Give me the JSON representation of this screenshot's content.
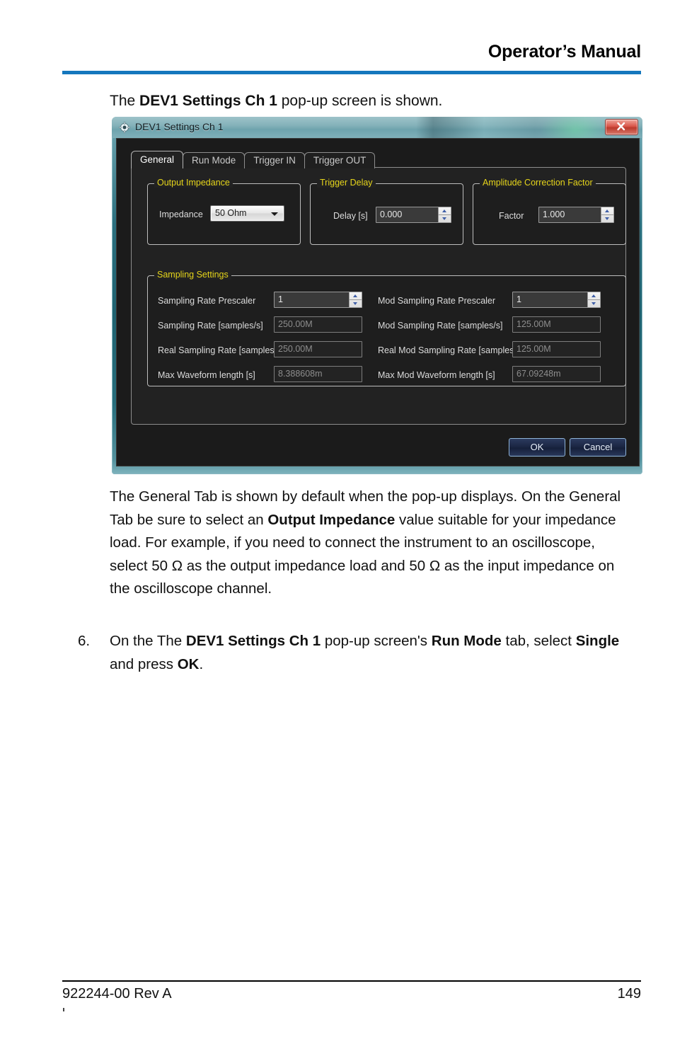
{
  "header": {
    "title": "Operator’s Manual"
  },
  "intro": {
    "before": "The ",
    "bold": "DEV1 Settings Ch 1",
    "after": " pop-up screen is shown."
  },
  "dialog": {
    "title": "DEV1 Settings Ch 1",
    "icon": "gear-icon",
    "close_label": "x",
    "tabs": [
      {
        "label": "General",
        "active": true
      },
      {
        "label": "Run Mode",
        "active": false
      },
      {
        "label": "Trigger IN",
        "active": false
      },
      {
        "label": "Trigger OUT",
        "active": false
      }
    ],
    "groups": {
      "output_impedance": {
        "legend": "Output Impedance",
        "field_label": "Impedance",
        "value": "50 Ohm",
        "options": [
          "50 Ohm"
        ]
      },
      "trigger_delay": {
        "legend": "Trigger Delay",
        "field_label": "Delay [s]",
        "value": "0.000"
      },
      "amplitude_correction": {
        "legend": "Amplitude Correction Factor",
        "field_label": "Factor",
        "value": "1.000"
      },
      "sampling_settings": {
        "legend": "Sampling Settings",
        "left_rows": [
          {
            "label": "Sampling Rate Prescaler",
            "value": "1",
            "type": "spin"
          },
          {
            "label": "Sampling Rate [samples/s]",
            "value": "250.00M",
            "type": "readonly"
          },
          {
            "label": "Real Sampling Rate [samples/s]",
            "value": "250.00M",
            "type": "readonly"
          },
          {
            "label": "Max Waveform length [s]",
            "value": "8.388608m",
            "type": "readonly"
          }
        ],
        "right_rows": [
          {
            "label": "Mod Sampling Rate Prescaler",
            "value": "1",
            "type": "spin"
          },
          {
            "label": "Mod Sampling Rate [samples/s]",
            "value": "125.00M",
            "type": "readonly"
          },
          {
            "label": "Real Mod Sampling Rate [samples/s]",
            "value": "125.00M",
            "type": "readonly"
          },
          {
            "label": "Max Mod Waveform length [s]",
            "value": "67.09248m",
            "type": "readonly"
          }
        ]
      }
    },
    "buttons": {
      "ok": "OK",
      "cancel": "Cancel"
    }
  },
  "paragraph": {
    "p1": "The General Tab is shown by default when the pop-up displays. On the General Tab be sure to select an ",
    "p1_bold": "Output Impedance",
    "p2": " value suitable for your impedance load. For example, if you need to connect the instrument to an oscilloscope, select 50 Ω as the output impedance load and 50 Ω as the input impedance on the oscilloscope channel."
  },
  "step": {
    "number": "6.",
    "t1": "On the The ",
    "b1": "DEV1 Settings Ch 1",
    "t2": " pop-up screen's ",
    "b2": "Run Mode",
    "t3": " tab, select ",
    "b3": "Single",
    "t4": " and press ",
    "b4": "OK",
    "t5": "."
  },
  "footer": {
    "doc_number": "922244-00 Rev A",
    "page_number": "149"
  },
  "colors": {
    "accent_rule": "#1577bd",
    "legend_yellow": "#e5d41a",
    "dialog_frame": "#2b6f7e"
  }
}
